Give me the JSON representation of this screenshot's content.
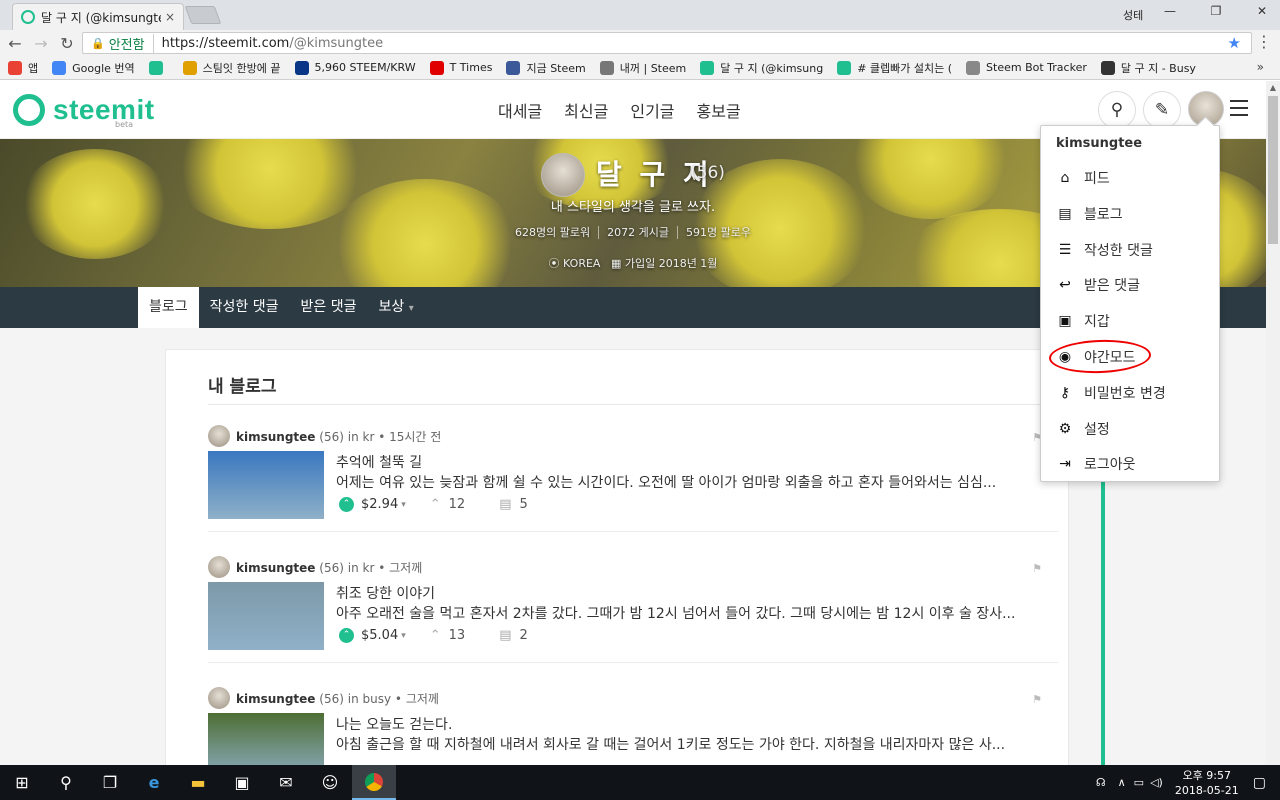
{
  "browser": {
    "tab_title": "달 구 지 (@kimsungtee)",
    "tab_close": "×",
    "window_user": "성테",
    "secure_label": "안전함",
    "url_host": "https://steemit.com",
    "url_path": "/@kimsungtee",
    "bookmarks": [
      {
        "label": "앱",
        "icon": "apps-grid-icon",
        "color": "#e94235"
      },
      {
        "label": "Google 번역",
        "icon": "google-translate-icon",
        "color": "#4285f4"
      },
      {
        "label": "",
        "icon": "steemit-icon",
        "color": "#1fbf8f"
      },
      {
        "label": "스팀잇 한방에 끝",
        "icon": "bookmark-icon",
        "color": "#e0a000"
      },
      {
        "label": "5,960 STEEM/KRW",
        "icon": "upbit-icon",
        "color": "#093687"
      },
      {
        "label": "T Times",
        "icon": "t-icon",
        "color": "#e00000"
      },
      {
        "label": "지금 Steem",
        "icon": "list-icon",
        "color": "#3b5998"
      },
      {
        "label": "내꺼 | Steem",
        "icon": "wordpress-icon",
        "color": "#777777"
      },
      {
        "label": "달 구 지 (@kimsung",
        "icon": "steemit-icon",
        "color": "#1fbf8f"
      },
      {
        "label": "# 클렙빠가 설치는 (",
        "icon": "steemit-icon",
        "color": "#1fbf8f"
      },
      {
        "label": "Steem Bot Tracker",
        "icon": "robot-icon",
        "color": "#888888"
      },
      {
        "label": "달 구 지 - Busy",
        "icon": "bolt-icon",
        "color": "#333333"
      }
    ],
    "bookmarks_more": "»"
  },
  "site": {
    "logo_text": "steemit",
    "logo_beta": "beta",
    "nav": [
      "대세글",
      "최신글",
      "인기글",
      "홍보글"
    ]
  },
  "profile": {
    "name": "달 구 지",
    "reputation": "(56)",
    "about": "내 스타일의 생각을 글로 쓰자.",
    "followers": "628명의 팔로워",
    "posts": "2072 게시글",
    "following": "591명 팔로우",
    "location": "KOREA",
    "joined": "가입일 2018년 1월",
    "tabs": [
      "블로그",
      "작성한 댓글",
      "받은 댓글",
      "보상"
    ],
    "tab_caret": "▾"
  },
  "blog": {
    "title": "내 블로그",
    "posts": [
      {
        "author": "kimsungtee",
        "rep": "(56)",
        "in": "in",
        "category": "kr",
        "time": "• 15시간 전",
        "title": "추억에 철뚝 길",
        "body": "어제는 여유 있는 늦잠과 함께 쉴 수 있는 시간이다. 오전에 딸 아이가 엄마랑 외출을 하고 혼자 들어와서는 심심...",
        "payout": "$2.94",
        "votes": "12",
        "comments": "5",
        "thumb_color": "#3a78c0"
      },
      {
        "author": "kimsungtee",
        "rep": "(56)",
        "in": "in",
        "category": "kr",
        "time": "• 그저께",
        "title": "취조 당한 이야기",
        "body": "아주 오래전 술을 먹고 혼자서 2차를 갔다. 그때가 밤 12시 넘어서 들어 갔다. 그때 당시에는 밤 12시 이후 술 장사...",
        "payout": "$5.04",
        "votes": "13",
        "comments": "2",
        "thumb_color": "#7d99a8"
      },
      {
        "author": "kimsungtee",
        "rep": "(56)",
        "in": "in",
        "category": "busy",
        "time": "• 그저께",
        "title": "나는 오늘도 걷는다.",
        "body": "아침 출근을 할 때 지하철에 내려서 회사로 갈 때는 걸어서 1키로 정도는 가야 한다. 지하철을 내리자마자 많은 사...",
        "payout": "",
        "votes": "",
        "comments": "",
        "thumb_color": "#4e6e34"
      }
    ]
  },
  "dropdown": {
    "username": "kimsungtee",
    "items": [
      {
        "label": "피드",
        "icon": "home-icon"
      },
      {
        "label": "블로그",
        "icon": "document-icon"
      },
      {
        "label": "작성한 댓글",
        "icon": "list-indent-icon"
      },
      {
        "label": "받은 댓글",
        "icon": "reply-arrow-icon"
      },
      {
        "label": "지갑",
        "icon": "wallet-icon"
      },
      {
        "label": "야간모드",
        "icon": "eye-icon"
      },
      {
        "label": "비밀번호 변경",
        "icon": "key-icon"
      },
      {
        "label": "설정",
        "icon": "gear-icon"
      },
      {
        "label": "로그아웃",
        "icon": "logout-icon"
      }
    ]
  },
  "taskbar": {
    "time": "오후 9:57",
    "date": "2018-05-21"
  },
  "colors": {
    "accent": "#1fbf8f",
    "subnav_bg": "#2c3a43",
    "annotation_red": "#e00000"
  }
}
